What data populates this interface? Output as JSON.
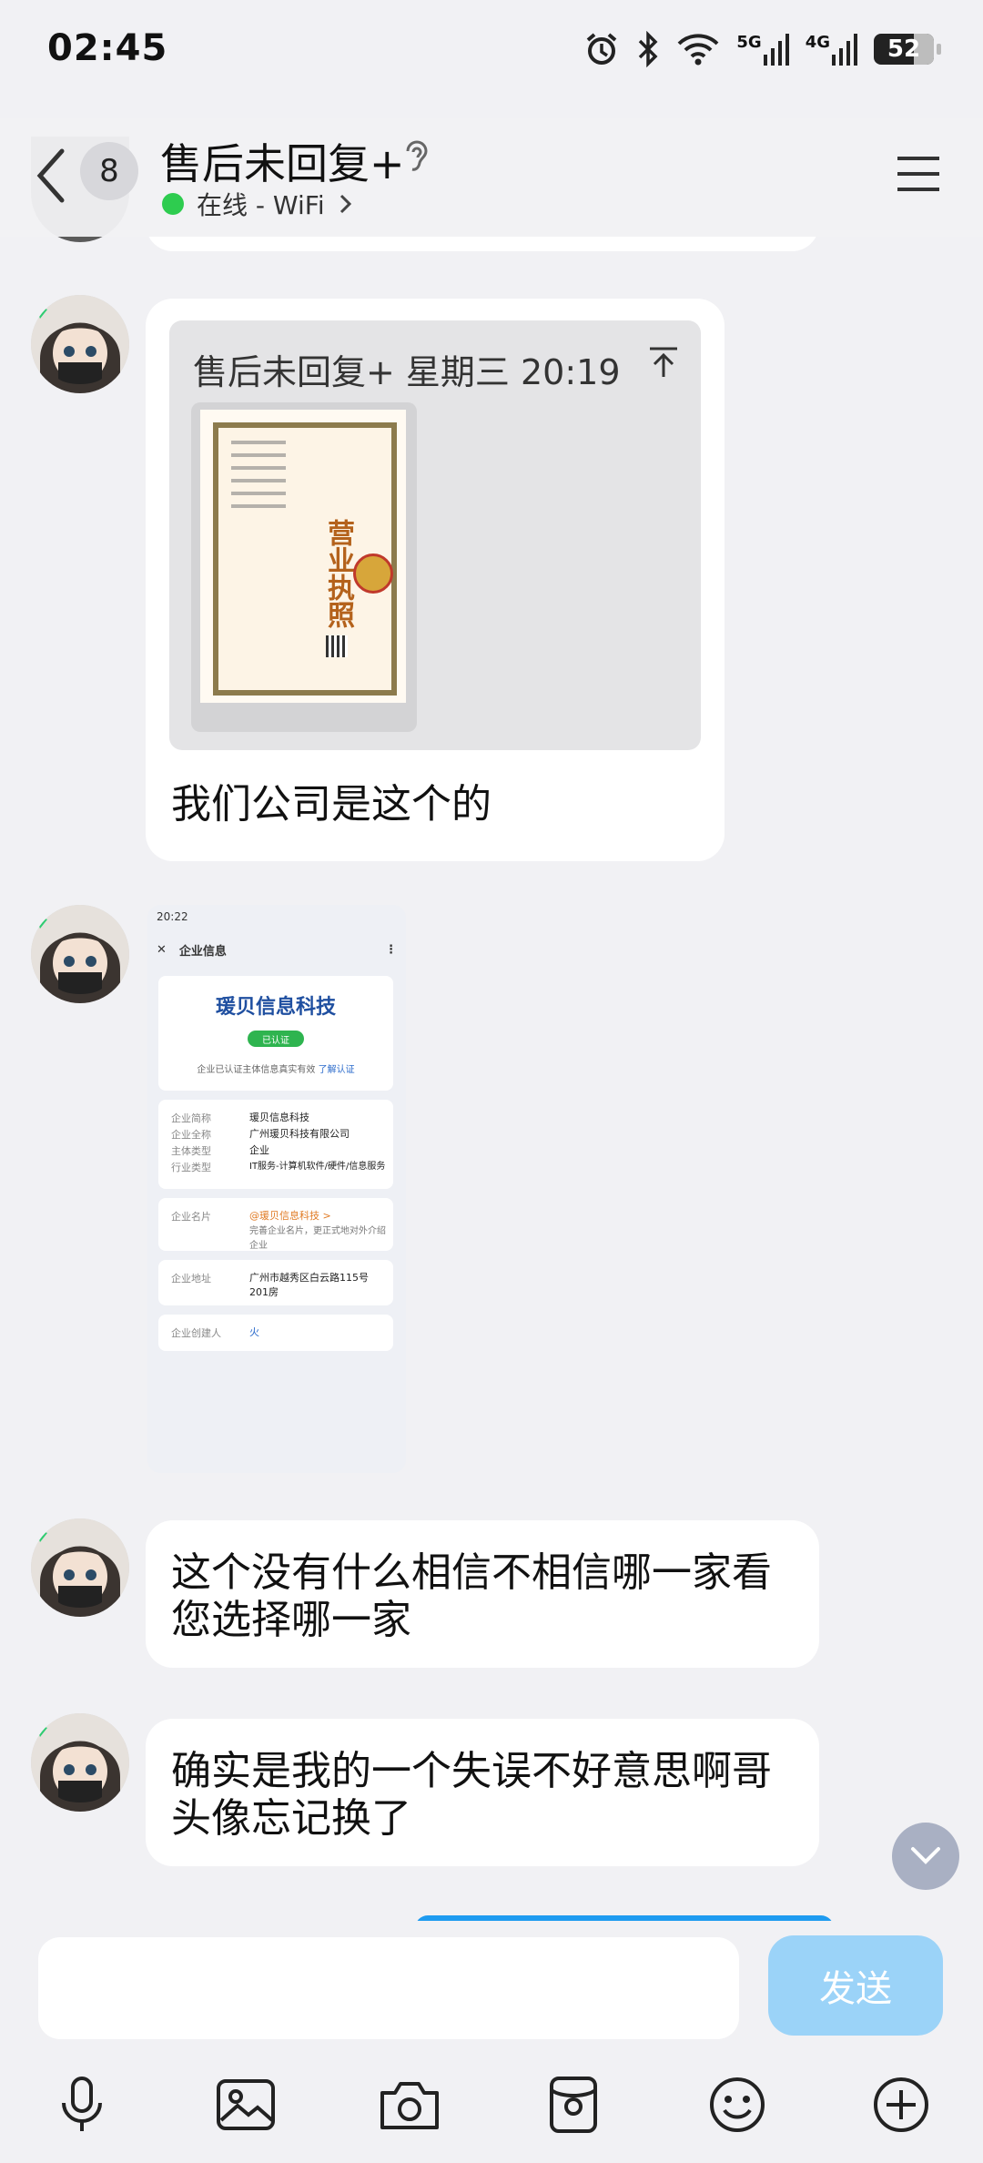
{
  "status_bar": {
    "time": "02:45",
    "network_5g": "5G",
    "network_4g": "4G",
    "battery": "52"
  },
  "header": {
    "unread_count": "8",
    "title": "售后未回复+",
    "presence": "在线 - WiFi",
    "presence_color": "#2ecc4f"
  },
  "messages": [
    {
      "type": "quote",
      "quote_meta": "售后未回复+ 星期三 20:19",
      "text": "我们公司是这个的",
      "license_title": "营业执照"
    },
    {
      "type": "image",
      "screenshot": {
        "status_time": "20:22",
        "bar_title": "企业信息",
        "company_name": "瑗贝信息科技",
        "verified_label": "已认证",
        "verified_note": "企业已认证主体信息真实有效",
        "verified_link": "了解认证",
        "rows": [
          {
            "k": "企业简称",
            "v": "瑗贝信息科技"
          },
          {
            "k": "企业全称",
            "v": "广州瑗贝科技有限公司"
          },
          {
            "k": "主体类型",
            "v": "企业"
          },
          {
            "k": "行业类型",
            "v": "IT服务-计算机软件/硬件/信息服务"
          }
        ],
        "card_label": "企业名片",
        "card_value": "@瑗贝信息科技 >",
        "card_sub": "完善企业名片，更正式地对外介绍企业",
        "address_label": "企业地址",
        "address_value": "广州市越秀区白云路115号201房",
        "founder_label": "企业创建人",
        "founder_value": "火"
      }
    },
    {
      "type": "text",
      "text_line1": "这个没有什么相信不相信哪一家看",
      "text_line2": "您选择哪一家"
    },
    {
      "type": "text",
      "text_line1": "确实是我的一个失误不好意思啊哥",
      "text_line2": "头像忘记换了"
    }
  ],
  "input": {
    "placeholder": "",
    "send_label": "发送"
  },
  "toolbar": [
    "microphone-icon",
    "image-icon",
    "camera-icon",
    "red-packet-icon",
    "emoji-icon",
    "plus-icon"
  ],
  "colors": {
    "background": "#f1f1f4",
    "send_button": "#9bd3f8",
    "company_name": "#1f4fa0"
  }
}
